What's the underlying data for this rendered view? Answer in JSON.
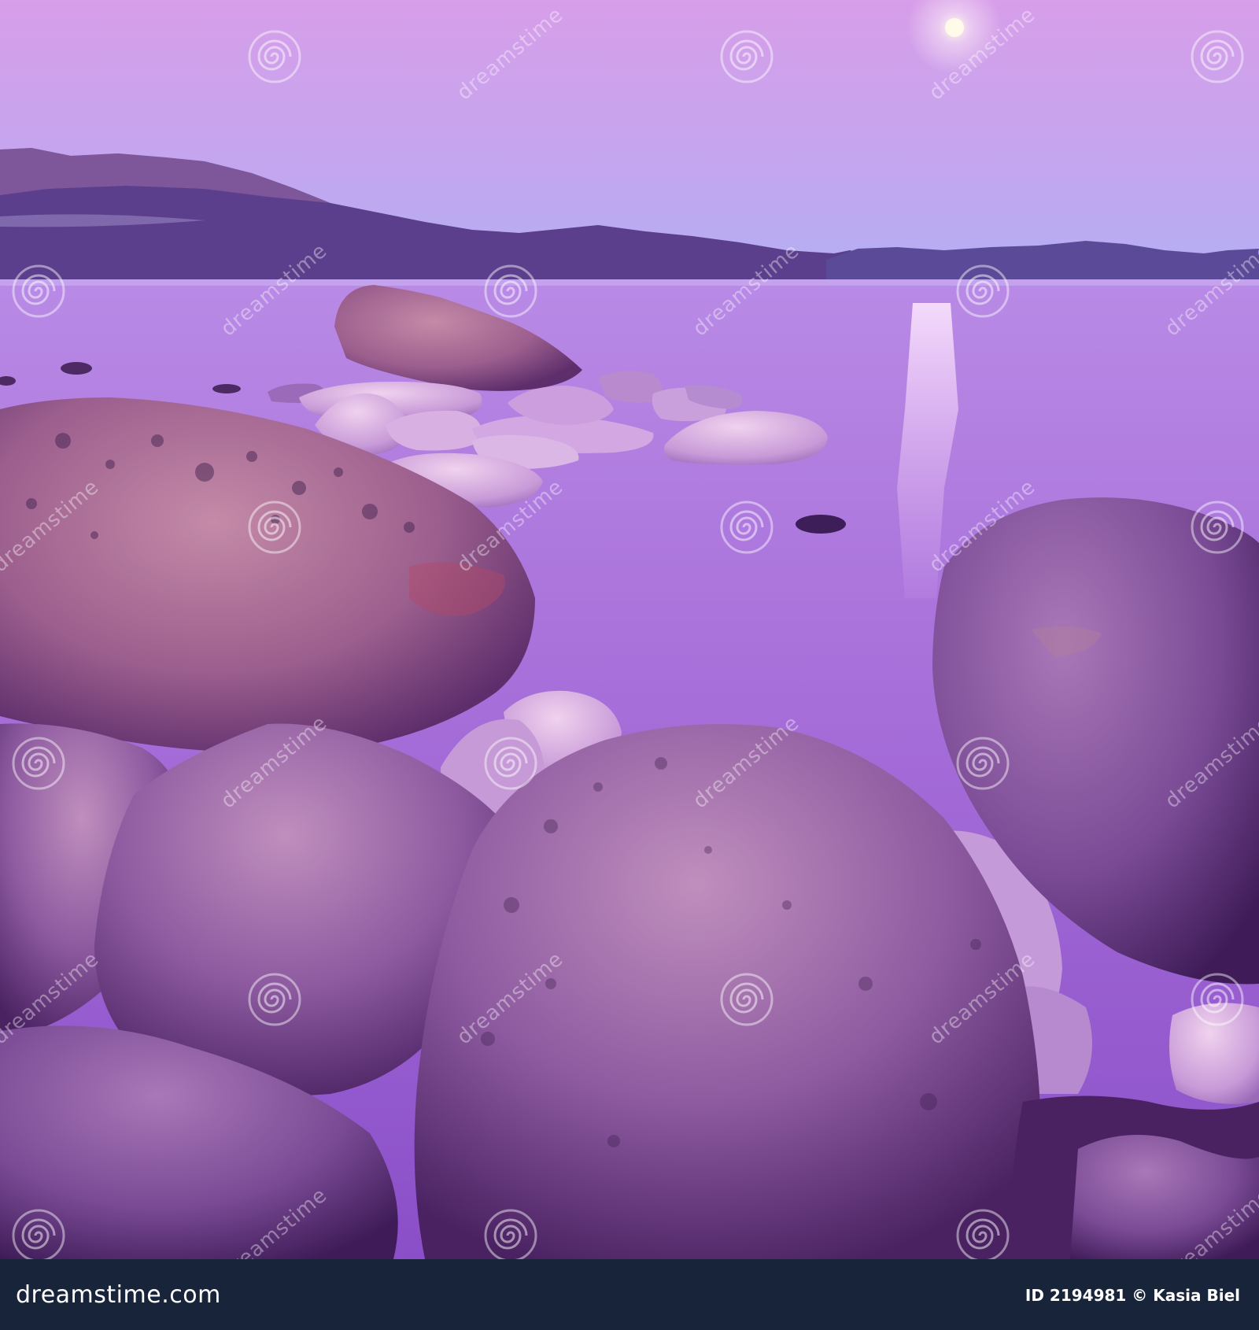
{
  "photo": {
    "subject": "lake shore with granite boulders under a rising moon at dusk",
    "palette": {
      "sky_top": "#d49be8",
      "sky_horizon": "#b8a6f2",
      "mountains": "#5a3f8e",
      "water": "#a86fd6",
      "moon": "#fff8e6",
      "boulder": "#a06c9a",
      "boulder_dark": "#5a2e6a"
    }
  },
  "watermark": {
    "brand_text": "dreamstime",
    "icon": "spiral-watermark-icon"
  },
  "footer": {
    "logo_text": "dreamstime.com",
    "credit": "ID 2194981 © Kasia Biel",
    "background": "#17243a"
  }
}
